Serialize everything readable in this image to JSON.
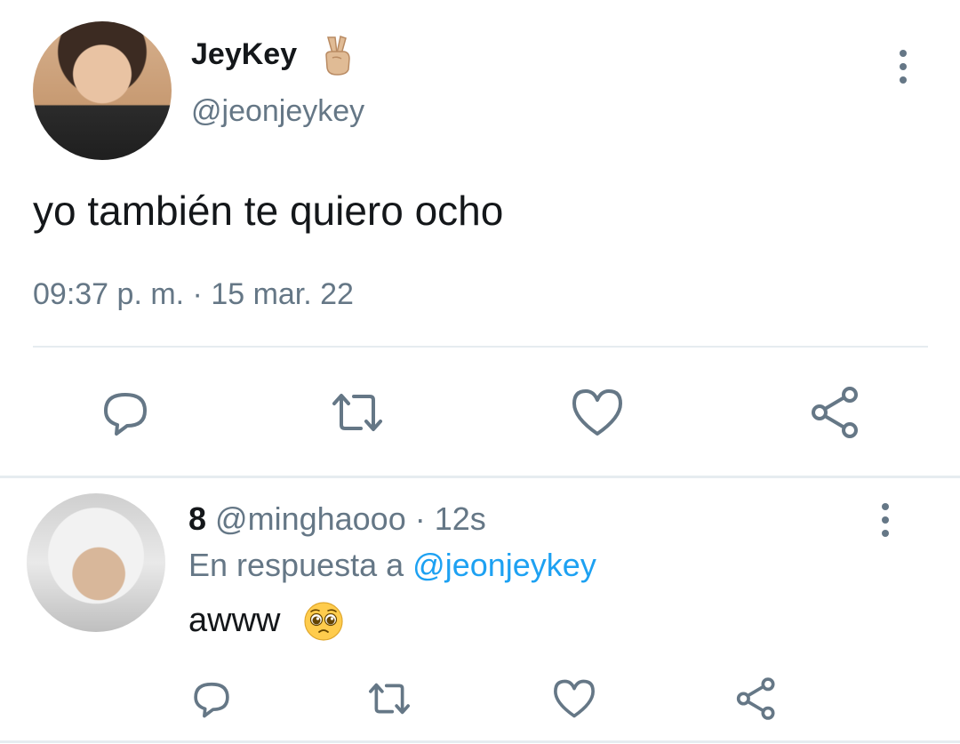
{
  "tweet": {
    "author_name": "JeyKey",
    "author_emoji": "victory-hand-icon",
    "author_handle": "@jeonjeykey",
    "text": "yo también te quiero ocho",
    "timestamp": "09:37 p. m. · 15 mar. 22",
    "actions": [
      "reply-icon",
      "retweet-icon",
      "like-icon",
      "share-icon"
    ]
  },
  "reply": {
    "author_name": "8",
    "author_handle": "@minghaooo",
    "separator": " · ",
    "age": "12s",
    "reply_prefix": "En respuesta a ",
    "reply_to_handle": "@jeonjeykey",
    "text": "awww",
    "text_emoji": "pleading-face-icon",
    "actions": [
      "reply-icon",
      "retweet-icon",
      "like-icon",
      "share-icon"
    ]
  },
  "colors": {
    "primary_text": "#14171a",
    "secondary_text": "#657786",
    "mention": "#1da1f2",
    "icon": "#657786",
    "divider": "#e6ecf0"
  }
}
